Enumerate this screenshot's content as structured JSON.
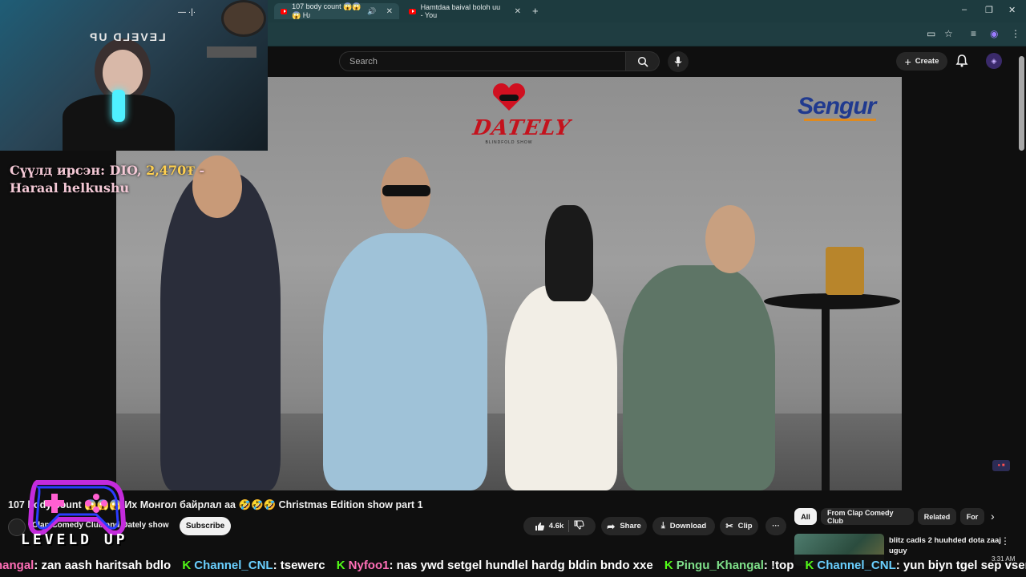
{
  "browser": {
    "tabs": [
      {
        "title": "107 body count 😱😱😱 Ƕ",
        "active": true
      },
      {
        "title": "Hamtdaa baival boloh uu - You",
        "active": false
      }
    ],
    "new_tab": "+",
    "window_controls": {
      "minimize": "–",
      "restore": "❐",
      "close": "✕"
    }
  },
  "youtube": {
    "search": {
      "placeholder": "Search"
    },
    "create_label": "Create",
    "video": {
      "title": "107 body count 😱😱😱 Их Монгол байрлал аа 🤣🤣🤣 Christmas Edition show part 1",
      "channel": "Clap Comedy Club and Dately show",
      "subscribe_label": "Subscribe",
      "likes": "4.6k",
      "share_label": "Share",
      "download_label": "Download",
      "clip_label": "Clip",
      "more_label": "···"
    },
    "chips": [
      "All",
      "From Clap Comedy Club",
      "Related",
      "For"
    ],
    "recommended": [
      {
        "title": "blitz cadis 2 huuhded dota zaaj uguy"
      }
    ]
  },
  "video_frame": {
    "show_logo": "DATELY",
    "show_logo_sub": "BLINDFOLD SHOW",
    "sponsor_logo": "Sengur"
  },
  "overlay": {
    "donation_label": "Сүүлд ирсэн:",
    "donation_name": "DIO,",
    "donation_amount": "2,470₮",
    "donation_dash": "-",
    "donation_message": "Haraal helkushu",
    "brand": "LEVELD UP",
    "clock": "3:31 AM"
  },
  "ticker": [
    {
      "name": "hangal",
      "message": ": zan aash haritsah bdlo",
      "color": "pink"
    },
    {
      "name": "Channel_CNL",
      "message": ": tsewerc",
      "color": "blue"
    },
    {
      "name": "Nyfoo1",
      "message": ": nas ywd setgel hundlel hardg bldin bndo xxe",
      "color": "pink"
    },
    {
      "name": "Pingu_Khangal",
      "message": ": !top",
      "color": "green"
    },
    {
      "name": "Channel_CNL",
      "message": ": yun biyn tgel sep vsertse",
      "color": "blue"
    }
  ],
  "colors": {
    "browser_chrome": "#1d3b3f",
    "youtube_bg": "#0f0f0f",
    "accent_red": "#ff0000",
    "kick_green": "#53fc18"
  }
}
